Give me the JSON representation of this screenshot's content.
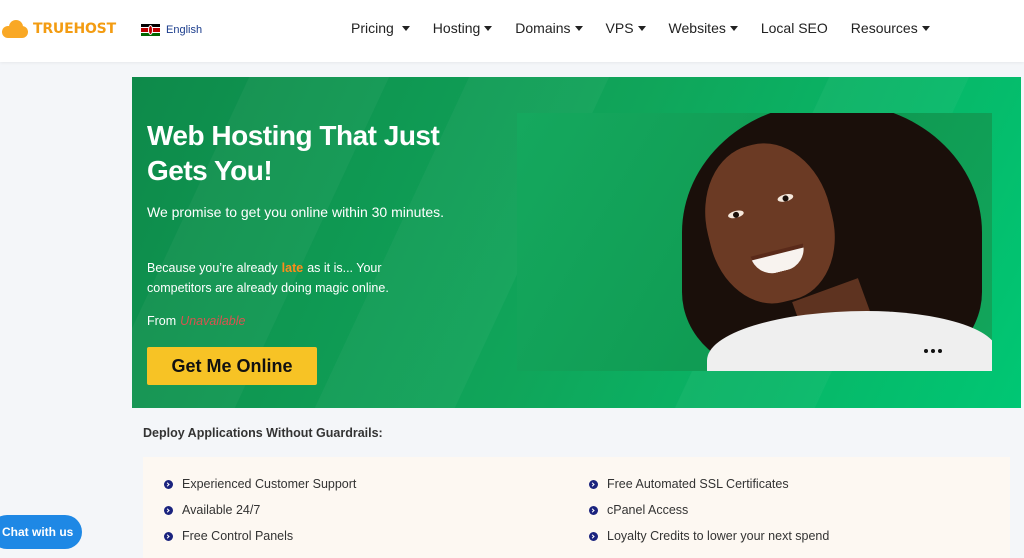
{
  "header": {
    "logo_text": "TRUEHOST",
    "language": "English",
    "nav": [
      {
        "label": "Pricing",
        "dropdown": true
      },
      {
        "label": "Hosting",
        "dropdown": true
      },
      {
        "label": "Domains",
        "dropdown": true
      },
      {
        "label": "VPS",
        "dropdown": true
      },
      {
        "label": "Websites",
        "dropdown": true
      },
      {
        "label": "Local SEO",
        "dropdown": false
      },
      {
        "label": "Resources",
        "dropdown": true
      }
    ]
  },
  "hero": {
    "title": "Web Hosting That Just Gets You!",
    "lead": "We promise to get you online within 30 minutes.",
    "sub_before": "Because you’re already",
    "sub_highlight": "late",
    "sub_after": "as it is... Your competitors are already doing magic online.",
    "from_label": "From",
    "price": "Unavailable",
    "cta_label": "Get Me Online"
  },
  "features": {
    "title": "Deploy Applications Without Guardrails:",
    "left": [
      "Experienced Customer Support",
      "Available 24/7",
      "Free Control Panels"
    ],
    "right": [
      "Free Automated SSL Certificates",
      "cPanel Access",
      "Loyalty Credits to lower your next spend"
    ]
  },
  "chat": {
    "label": "Chat with us"
  },
  "colors": {
    "brand": "#f39c12",
    "hero_green": "#10a55a",
    "cta_yellow": "#f7c325",
    "chat_blue": "#1e88e5"
  }
}
